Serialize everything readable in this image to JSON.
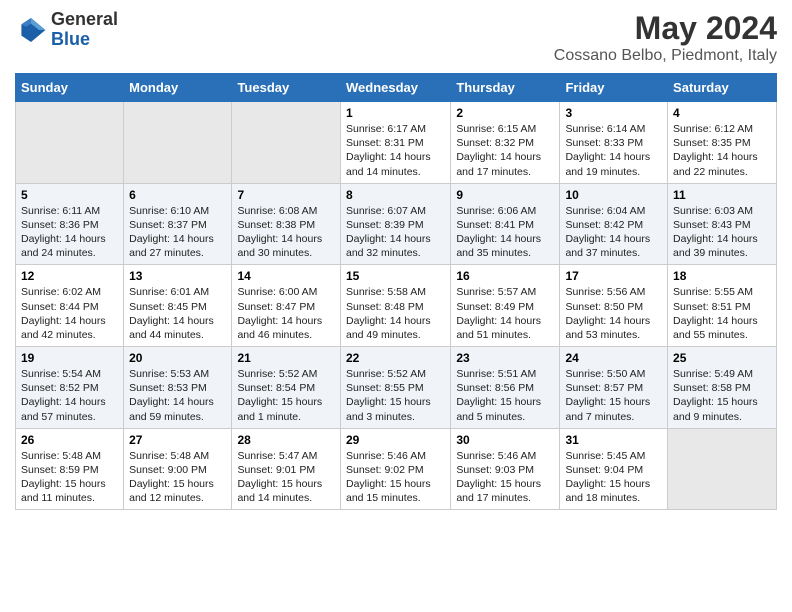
{
  "logo": {
    "general": "General",
    "blue": "Blue"
  },
  "title": "May 2024",
  "subtitle": "Cossano Belbo, Piedmont, Italy",
  "days_of_week": [
    "Sunday",
    "Monday",
    "Tuesday",
    "Wednesday",
    "Thursday",
    "Friday",
    "Saturday"
  ],
  "weeks": [
    [
      {
        "day": "",
        "content": ""
      },
      {
        "day": "",
        "content": ""
      },
      {
        "day": "",
        "content": ""
      },
      {
        "day": "1",
        "content": "Sunrise: 6:17 AM\nSunset: 8:31 PM\nDaylight: 14 hours and 14 minutes."
      },
      {
        "day": "2",
        "content": "Sunrise: 6:15 AM\nSunset: 8:32 PM\nDaylight: 14 hours and 17 minutes."
      },
      {
        "day": "3",
        "content": "Sunrise: 6:14 AM\nSunset: 8:33 PM\nDaylight: 14 hours and 19 minutes."
      },
      {
        "day": "4",
        "content": "Sunrise: 6:12 AM\nSunset: 8:35 PM\nDaylight: 14 hours and 22 minutes."
      }
    ],
    [
      {
        "day": "5",
        "content": "Sunrise: 6:11 AM\nSunset: 8:36 PM\nDaylight: 14 hours and 24 minutes."
      },
      {
        "day": "6",
        "content": "Sunrise: 6:10 AM\nSunset: 8:37 PM\nDaylight: 14 hours and 27 minutes."
      },
      {
        "day": "7",
        "content": "Sunrise: 6:08 AM\nSunset: 8:38 PM\nDaylight: 14 hours and 30 minutes."
      },
      {
        "day": "8",
        "content": "Sunrise: 6:07 AM\nSunset: 8:39 PM\nDaylight: 14 hours and 32 minutes."
      },
      {
        "day": "9",
        "content": "Sunrise: 6:06 AM\nSunset: 8:41 PM\nDaylight: 14 hours and 35 minutes."
      },
      {
        "day": "10",
        "content": "Sunrise: 6:04 AM\nSunset: 8:42 PM\nDaylight: 14 hours and 37 minutes."
      },
      {
        "day": "11",
        "content": "Sunrise: 6:03 AM\nSunset: 8:43 PM\nDaylight: 14 hours and 39 minutes."
      }
    ],
    [
      {
        "day": "12",
        "content": "Sunrise: 6:02 AM\nSunset: 8:44 PM\nDaylight: 14 hours and 42 minutes."
      },
      {
        "day": "13",
        "content": "Sunrise: 6:01 AM\nSunset: 8:45 PM\nDaylight: 14 hours and 44 minutes."
      },
      {
        "day": "14",
        "content": "Sunrise: 6:00 AM\nSunset: 8:47 PM\nDaylight: 14 hours and 46 minutes."
      },
      {
        "day": "15",
        "content": "Sunrise: 5:58 AM\nSunset: 8:48 PM\nDaylight: 14 hours and 49 minutes."
      },
      {
        "day": "16",
        "content": "Sunrise: 5:57 AM\nSunset: 8:49 PM\nDaylight: 14 hours and 51 minutes."
      },
      {
        "day": "17",
        "content": "Sunrise: 5:56 AM\nSunset: 8:50 PM\nDaylight: 14 hours and 53 minutes."
      },
      {
        "day": "18",
        "content": "Sunrise: 5:55 AM\nSunset: 8:51 PM\nDaylight: 14 hours and 55 minutes."
      }
    ],
    [
      {
        "day": "19",
        "content": "Sunrise: 5:54 AM\nSunset: 8:52 PM\nDaylight: 14 hours and 57 minutes."
      },
      {
        "day": "20",
        "content": "Sunrise: 5:53 AM\nSunset: 8:53 PM\nDaylight: 14 hours and 59 minutes."
      },
      {
        "day": "21",
        "content": "Sunrise: 5:52 AM\nSunset: 8:54 PM\nDaylight: 15 hours and 1 minute."
      },
      {
        "day": "22",
        "content": "Sunrise: 5:52 AM\nSunset: 8:55 PM\nDaylight: 15 hours and 3 minutes."
      },
      {
        "day": "23",
        "content": "Sunrise: 5:51 AM\nSunset: 8:56 PM\nDaylight: 15 hours and 5 minutes."
      },
      {
        "day": "24",
        "content": "Sunrise: 5:50 AM\nSunset: 8:57 PM\nDaylight: 15 hours and 7 minutes."
      },
      {
        "day": "25",
        "content": "Sunrise: 5:49 AM\nSunset: 8:58 PM\nDaylight: 15 hours and 9 minutes."
      }
    ],
    [
      {
        "day": "26",
        "content": "Sunrise: 5:48 AM\nSunset: 8:59 PM\nDaylight: 15 hours and 11 minutes."
      },
      {
        "day": "27",
        "content": "Sunrise: 5:48 AM\nSunset: 9:00 PM\nDaylight: 15 hours and 12 minutes."
      },
      {
        "day": "28",
        "content": "Sunrise: 5:47 AM\nSunset: 9:01 PM\nDaylight: 15 hours and 14 minutes."
      },
      {
        "day": "29",
        "content": "Sunrise: 5:46 AM\nSunset: 9:02 PM\nDaylight: 15 hours and 15 minutes."
      },
      {
        "day": "30",
        "content": "Sunrise: 5:46 AM\nSunset: 9:03 PM\nDaylight: 15 hours and 17 minutes."
      },
      {
        "day": "31",
        "content": "Sunrise: 5:45 AM\nSunset: 9:04 PM\nDaylight: 15 hours and 18 minutes."
      },
      {
        "day": "",
        "content": ""
      }
    ]
  ]
}
